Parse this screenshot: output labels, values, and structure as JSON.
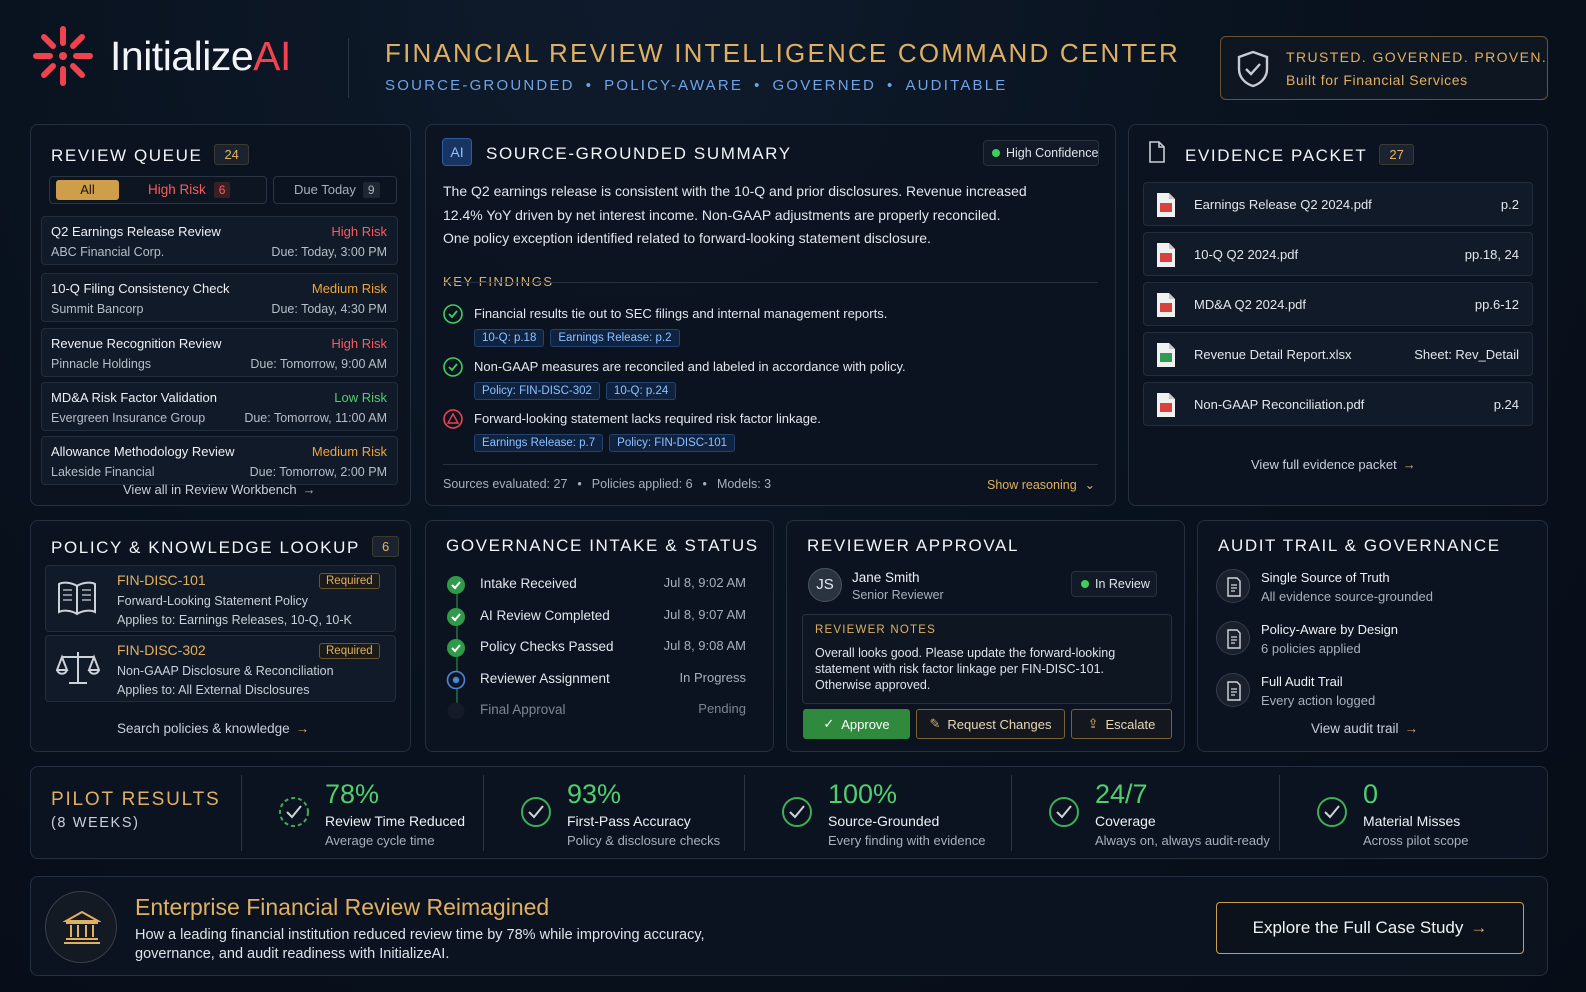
{
  "header": {
    "brand_prefix": "Initialize",
    "brand_suffix": "AI",
    "title": "FINANCIAL REVIEW INTELLIGENCE COMMAND CENTER",
    "subtitle": [
      "SOURCE-GROUNDED",
      "POLICY-AWARE",
      "GOVERNED",
      "AUDITABLE"
    ],
    "trust_line1": "TRUSTED. GOVERNED. PROVEN.",
    "trust_line2": "Built for Financial Services"
  },
  "queue": {
    "title": "REVIEW QUEUE",
    "count": "24",
    "filters": {
      "all": "All",
      "high_risk": "High Risk",
      "high_risk_count": "6",
      "due_today": "Due Today",
      "due_today_count": "9"
    },
    "items": [
      {
        "title": "Q2 Earnings Release Review",
        "org": "ABC Financial Corp.",
        "risk": "High Risk",
        "due": "Due: Today, 3:00 PM"
      },
      {
        "title": "10-Q Filing Consistency Check",
        "org": "Summit Bancorp",
        "risk": "Medium Risk",
        "due": "Due: Today, 4:30 PM"
      },
      {
        "title": "Revenue Recognition Review",
        "org": "Pinnacle Holdings",
        "risk": "High Risk",
        "due": "Due: Tomorrow, 9:00 AM"
      },
      {
        "title": "MD&A Risk Factor Validation",
        "org": "Evergreen Insurance Group",
        "risk": "Low Risk",
        "due": "Due: Tomorrow, 11:00 AM"
      },
      {
        "title": "Allowance Methodology Review",
        "org": "Lakeside Financial",
        "risk": "Medium Risk",
        "due": "Due: Tomorrow, 2:00 PM"
      }
    ],
    "view_all": "View all in Review Workbench"
  },
  "summary": {
    "ai_badge": "AI",
    "title": "SOURCE-GROUNDED SUMMARY",
    "confidence": "High Confidence",
    "body": [
      "The Q2 earnings release is consistent with the 10-Q and prior disclosures. Revenue increased",
      "12.4% YoY driven by net interest income. Non-GAAP adjustments are properly reconciled.",
      "One policy exception identified related to forward-looking statement disclosure."
    ],
    "findings_label": "KEY FINDINGS",
    "findings": [
      {
        "text": "Financial results tie out to SEC filings and internal management reports.",
        "chips": [
          "10-Q: p.18",
          "Earnings Release: p.2"
        ]
      },
      {
        "text": "Non-GAAP measures are reconciled and labeled in accordance with policy.",
        "chips": [
          "Policy: FIN-DISC-302",
          "10-Q: p.24"
        ]
      },
      {
        "text": "Forward-looking statement lacks required risk factor linkage.",
        "chips": [
          "Earnings Release: p.7",
          "Policy: FIN-DISC-101"
        ]
      }
    ],
    "sources": "Sources evaluated: 27",
    "policies": "Policies applied: 6",
    "models": "Models: 3",
    "show_reasoning": "Show reasoning"
  },
  "evidence": {
    "title": "EVIDENCE PACKET",
    "count": "27",
    "files": [
      {
        "name": "Earnings Release Q2 2024.pdf",
        "ref": "p.2",
        "kind": "pdf"
      },
      {
        "name": "10-Q Q2 2024.pdf",
        "ref": "pp.18, 24",
        "kind": "pdf"
      },
      {
        "name": "MD&A Q2 2024.pdf",
        "ref": "pp.6-12",
        "kind": "pdf"
      },
      {
        "name": "Revenue Detail Report.xlsx",
        "ref": "Sheet: Rev_Detail",
        "kind": "xlsx"
      },
      {
        "name": "Non-GAAP Reconciliation.pdf",
        "ref": "p.24",
        "kind": "pdf"
      }
    ],
    "view_full": "View full evidence packet"
  },
  "policy": {
    "title": "POLICY & KNOWLEDGE LOOKUP",
    "count": "6",
    "items": [
      {
        "id": "FIN-DISC-101",
        "tag": "Required",
        "name": "Forward-Looking Statement Policy",
        "applies": "Applies to: Earnings Releases, 10-Q, 10-K"
      },
      {
        "id": "FIN-DISC-302",
        "tag": "Required",
        "name": "Non-GAAP Disclosure & Reconciliation",
        "applies": "Applies to: All External Disclosures"
      }
    ],
    "search": "Search policies & knowledge"
  },
  "governance": {
    "title": "GOVERNANCE INTAKE & STATUS",
    "steps": [
      {
        "label": "Intake Received",
        "time": "Jul 8, 9:02 AM",
        "state": "done"
      },
      {
        "label": "AI Review Completed",
        "time": "Jul 8, 9:07 AM",
        "state": "done"
      },
      {
        "label": "Policy Checks Passed",
        "time": "Jul 8, 9:08 AM",
        "state": "done"
      },
      {
        "label": "Reviewer Assignment",
        "time": "In Progress",
        "state": "active"
      },
      {
        "label": "Final Approval",
        "time": "Pending",
        "state": "pending"
      }
    ]
  },
  "approval": {
    "title": "REVIEWER APPROVAL",
    "initials": "JS",
    "name": "Jane Smith",
    "role": "Senior Reviewer",
    "status": "In Review",
    "notes_label": "REVIEWER NOTES",
    "notes": [
      "Overall looks good. Please update the forward-looking",
      "statement with risk factor linkage per FIN-DISC-101.",
      "Otherwise approved."
    ],
    "approve": "Approve",
    "request_changes": "Request Changes",
    "escalate": "Escalate"
  },
  "audit": {
    "title": "AUDIT TRAIL & GOVERNANCE",
    "items": [
      {
        "title": "Single Source of Truth",
        "sub": "All evidence source-grounded"
      },
      {
        "title": "Policy-Aware by Design",
        "sub": "6 policies applied"
      },
      {
        "title": "Full Audit Trail",
        "sub": "Every action logged"
      }
    ],
    "view": "View audit trail"
  },
  "pilot": {
    "title": "PILOT RESULTS",
    "period": "(8 WEEKS)",
    "metrics": [
      {
        "value": "78%",
        "label": "Review Time Reduced",
        "sub": "Average cycle time"
      },
      {
        "value": "93%",
        "label": "First-Pass Accuracy",
        "sub": "Policy & disclosure checks"
      },
      {
        "value": "100%",
        "label": "Source-Grounded",
        "sub": "Every finding with evidence"
      },
      {
        "value": "24/7",
        "label": "Coverage",
        "sub": "Always on, always audit-ready"
      },
      {
        "value": "0",
        "label": "Material Misses",
        "sub": "Across pilot scope"
      }
    ]
  },
  "cta": {
    "heading": "Enterprise Financial Review Reimagined",
    "body1": "How a leading financial institution reduced review time by 78% while improving accuracy,",
    "body2": "governance, and audit readiness with InitializeAI.",
    "button": "Explore the Full Case Study"
  },
  "colors": {
    "accent_gold": "#e0b061",
    "brand_red": "#f0424f",
    "high": "#ff5a5a",
    "medium": "#f2a33a",
    "low": "#4fcf6e",
    "approve": "#2f8a3d"
  }
}
